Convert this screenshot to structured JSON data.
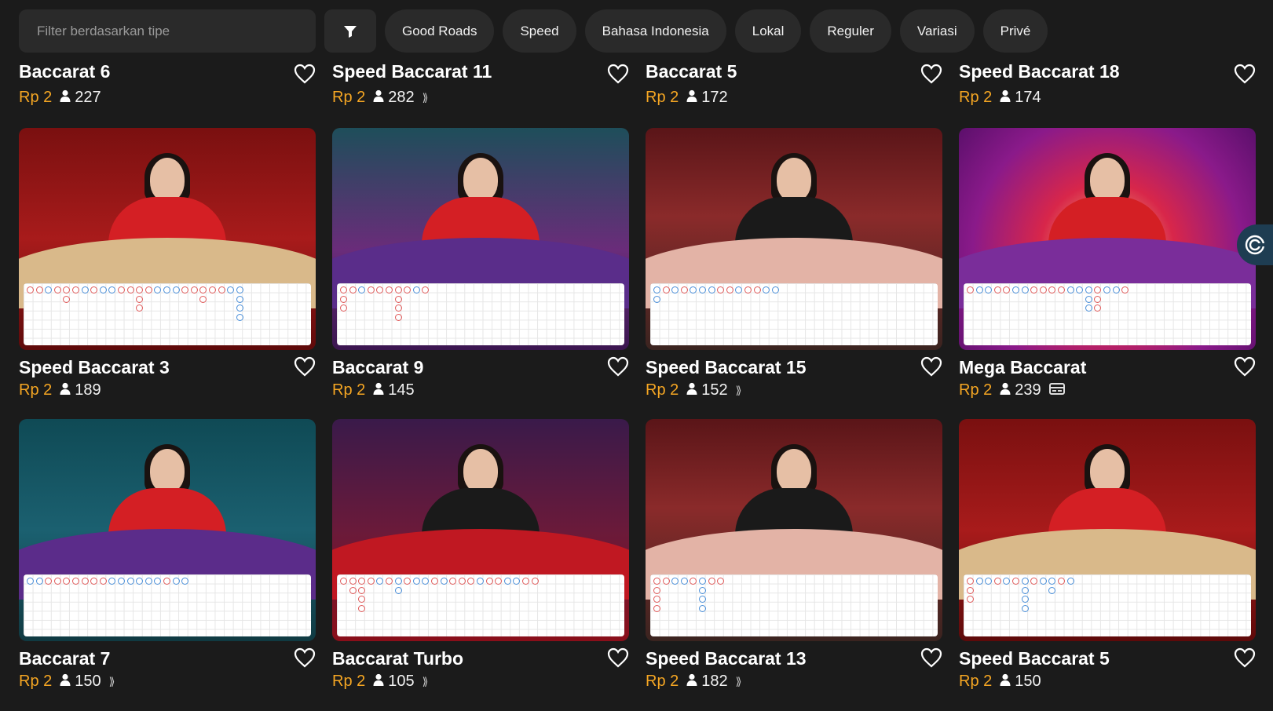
{
  "filter": {
    "placeholder": "Filter berdasarkan tipe",
    "chips": [
      "Good Roads",
      "Speed",
      "Bahasa Indonesia",
      "Lokal",
      "Reguler",
      "Variasi",
      "Privé"
    ]
  },
  "top_row": [
    {
      "title": "Baccarat 6",
      "price": "Rp 2",
      "players": "227",
      "sound": false
    },
    {
      "title": "Speed Baccarat 11",
      "price": "Rp 2",
      "players": "282",
      "sound": true
    },
    {
      "title": "Baccarat 5",
      "price": "Rp 2",
      "players": "172",
      "sound": false
    },
    {
      "title": "Speed Baccarat 18",
      "price": "Rp 2",
      "players": "174",
      "sound": false
    }
  ],
  "rows": [
    [
      {
        "title": "Speed Baccarat 3",
        "price": "Rp 2",
        "players": "189",
        "sound": false,
        "theme": "red"
      },
      {
        "title": "Baccarat 9",
        "price": "Rp 2",
        "players": "145",
        "sound": false,
        "theme": "purple"
      },
      {
        "title": "Speed Baccarat 15",
        "price": "Rp 2",
        "players": "152",
        "sound": true,
        "theme": "pink"
      },
      {
        "title": "Mega Baccarat",
        "price": "Rp 2",
        "players": "239",
        "sound": false,
        "badge": "card-icon",
        "theme": "mega"
      }
    ],
    [
      {
        "title": "Baccarat 7",
        "price": "Rp 2",
        "players": "150",
        "sound": true,
        "theme": "teal"
      },
      {
        "title": "Baccarat Turbo",
        "price": "Rp 2",
        "players": "105",
        "sound": true,
        "theme": "turbo"
      },
      {
        "title": "Speed Baccarat 13",
        "price": "Rp 2",
        "players": "182",
        "sound": true,
        "theme": "pink"
      },
      {
        "title": "Speed Baccarat 5",
        "price": "Rp 2",
        "players": "150",
        "sound": false,
        "theme": "red"
      }
    ]
  ],
  "colors": {
    "accent": "#f5a623",
    "banker": "#e05a5a",
    "player": "#4a8fd9"
  }
}
